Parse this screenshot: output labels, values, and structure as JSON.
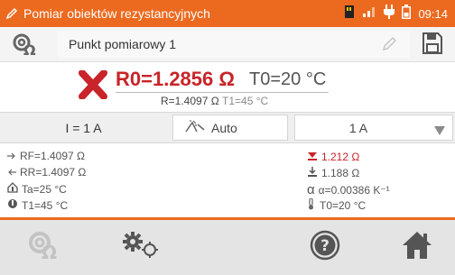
{
  "status_bar": {
    "title": "Pomiar obiektów rezystancyjnych",
    "time": "09:14",
    "icons": [
      "pen-icon",
      "memory-card-icon",
      "signal-icon",
      "plug-icon",
      "battery-icon"
    ]
  },
  "header": {
    "point_name": "Punkt pomiarowy 1",
    "icons": [
      "ohm-logo-icon",
      "edit-icon",
      "save-icon"
    ]
  },
  "result": {
    "status_icon": "fail-x-icon",
    "r0": "R0=1.2856 Ω",
    "t0": "T0=20 °C",
    "r_measured": "R=1.4097 Ω",
    "t1": "T1=45 °C"
  },
  "settings": {
    "current": "I = 1 A",
    "mode": "Auto",
    "range": "1 A"
  },
  "details": {
    "rf": "RF=1.4097 Ω",
    "rr": "RR=1.4097 Ω",
    "ta": "Ta=25 °C",
    "t1": "T1=45 °C",
    "r_red": "1.212 Ω",
    "r_down": "1.188 Ω",
    "alpha": "α=0.00386 K⁻¹",
    "t0": "T0=20 °C"
  },
  "bottom_bar": {
    "icons": [
      "ohm-logo-disabled-icon",
      "settings-gears-icon",
      "help-icon",
      "home-icon"
    ]
  },
  "colors": {
    "accent": "#ec6a1f",
    "error_red": "#c8242a"
  }
}
